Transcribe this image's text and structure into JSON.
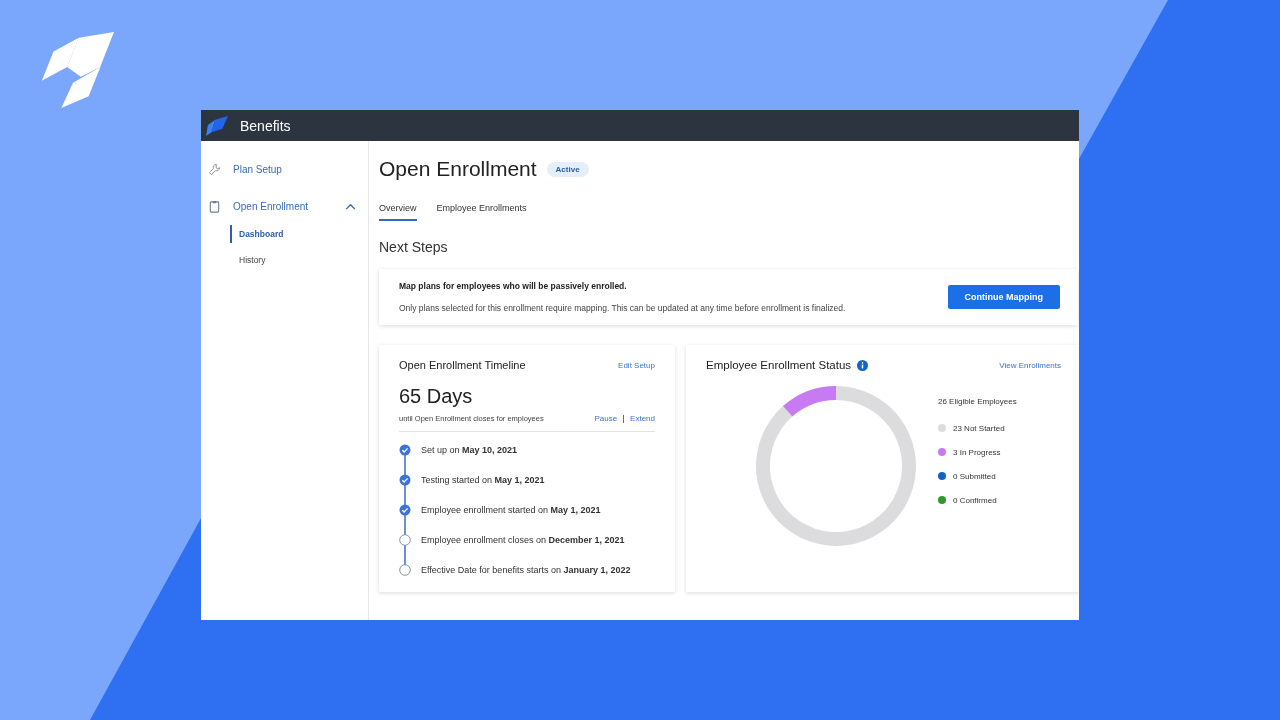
{
  "app_bar": {
    "title": "Benefits"
  },
  "sidebar": {
    "items": [
      {
        "label": "Plan Setup",
        "selected": false
      },
      {
        "label": "Open Enrollment",
        "selected": false,
        "expanded": true,
        "children": [
          {
            "label": "Dashboard",
            "selected": true
          },
          {
            "label": "History",
            "selected": false
          }
        ]
      }
    ]
  },
  "page": {
    "title": "Open Enrollment",
    "status_badge": "Active"
  },
  "tabs": [
    {
      "label": "Overview",
      "selected": true
    },
    {
      "label": "Employee Enrollments",
      "selected": false
    }
  ],
  "next_steps": {
    "heading": "Next Steps",
    "title": "Map plans for employees who will be passively enrolled.",
    "description": "Only plans selected for this enrollment require mapping. This can be updated at any time before enrollment is finalized.",
    "button": "Continue Mapping"
  },
  "timeline": {
    "title": "Open Enrollment Timeline",
    "edit_link": "Edit Setup",
    "days": "65 Days",
    "caption": "until Open Enrollment closes for employees",
    "actions": [
      "Pause",
      "Extend"
    ],
    "steps": [
      {
        "text": "Set up on **May 10, 2021**",
        "done": true
      },
      {
        "text": "Testing started on **May 1, 2021**",
        "done": true
      },
      {
        "text": "Employee enrollment started on **May 1, 2021**",
        "done": true
      },
      {
        "text": "Employee enrollment closes on **December 1, 2021**",
        "done": false
      },
      {
        "text": "Effective Date for benefits starts on **January 1, 2022**",
        "done": false
      }
    ]
  },
  "status": {
    "title": "Employee Enrollment Status",
    "link": "View Enrollments",
    "legend_title": "26 Eligible Employees",
    "legend": [
      {
        "color": "#dcdcdf"
      },
      {
        "color": "#c77af2"
      },
      {
        "color": "#1463c8"
      },
      {
        "color": "#2e9a2e"
      }
    ],
    "chart_data": {
      "type": "donut",
      "categories": [
        "23 Not Started",
        "3 In Progress",
        "0 Submitted",
        "0 Confirmed"
      ],
      "values": [
        23,
        3,
        0,
        0
      ]
    }
  }
}
